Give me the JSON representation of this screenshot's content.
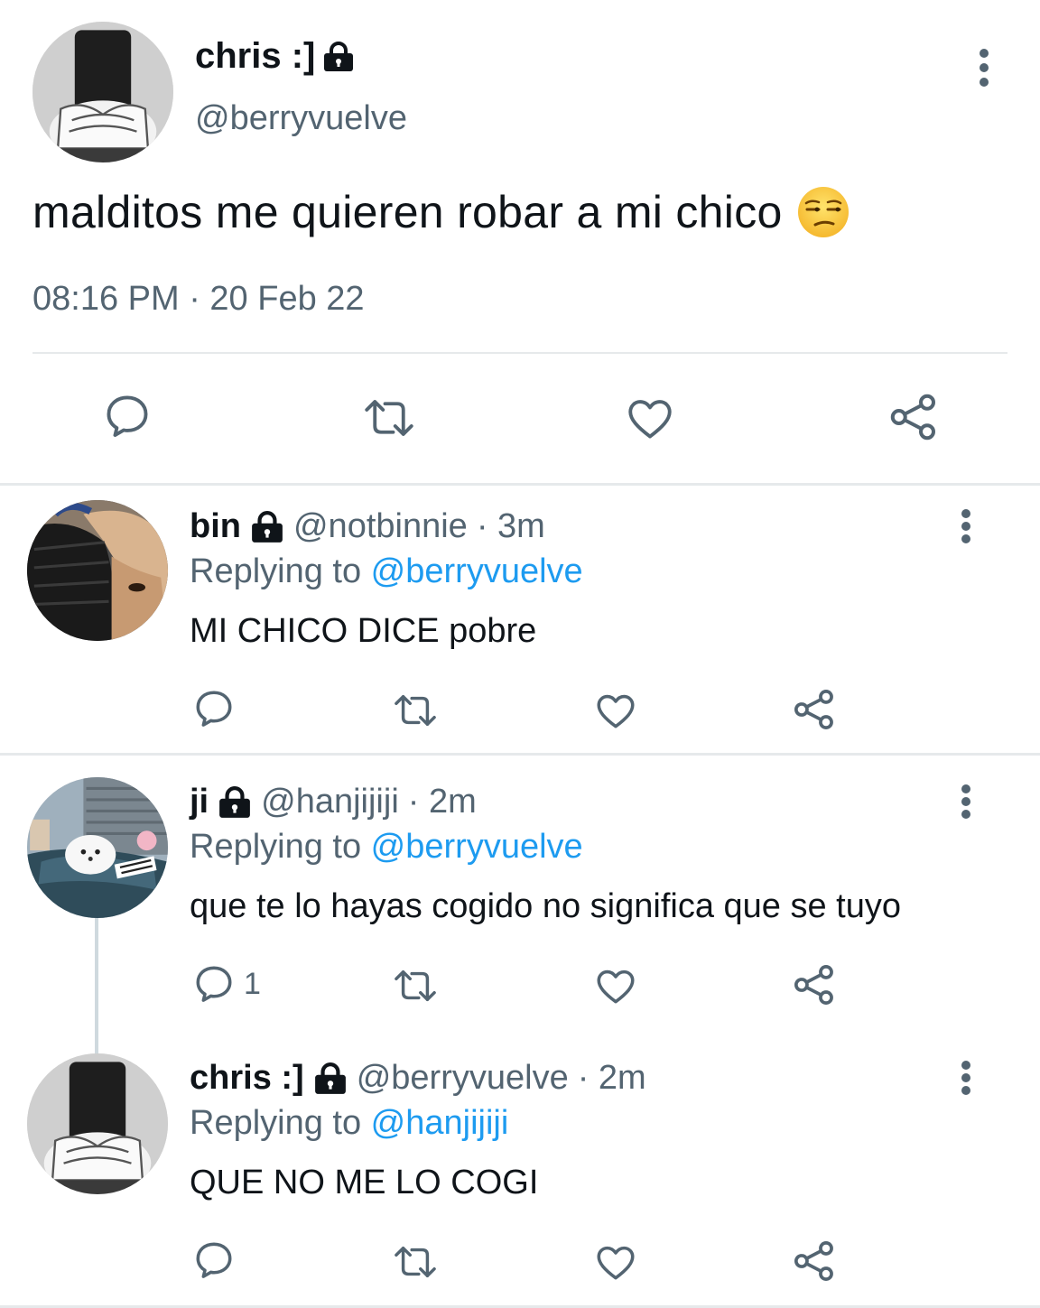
{
  "main_tweet": {
    "name": "chris :]",
    "handle": "@berryvuelve",
    "text": "malditos me quieren robar a mi chico",
    "emoji": "unamused-face",
    "timestamp": "08:16 PM · 20 Feb 22"
  },
  "replies": [
    {
      "name": "bin",
      "handle": "@notbinnie",
      "time": "· 3m",
      "replying_label": "Replying to ",
      "replying_to": "@berryvuelve",
      "text": "MI CHICO DICE pobre",
      "reply_count": ""
    },
    {
      "name": "ji",
      "handle": "@hanjijiji",
      "time": "· 2m",
      "replying_label": "Replying to ",
      "replying_to": "@berryvuelve",
      "text": "que te lo hayas cogido no significa que se tuyo",
      "reply_count": "1"
    },
    {
      "name": "chris :]",
      "handle": "@berryvuelve",
      "time": "· 2m",
      "replying_label": "Replying to ",
      "replying_to": "@hanjijiji",
      "text": "QUE NO ME LO COGI",
      "reply_count": ""
    }
  ],
  "colors": {
    "accent": "#1d9bf0",
    "secondary_text": "#536471",
    "icon": "#536471",
    "divider": "#e6e9eb"
  },
  "icons": [
    "lock-icon",
    "more-icon",
    "reply-icon",
    "retweet-icon",
    "like-icon",
    "share-icon"
  ]
}
